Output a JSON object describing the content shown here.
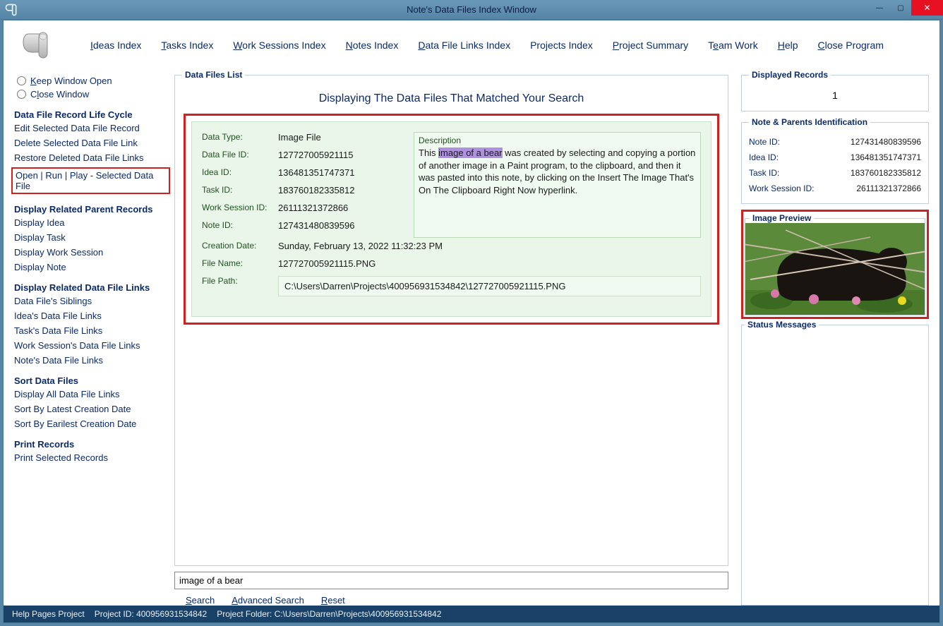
{
  "window": {
    "title": "Note's Data Files Index Window"
  },
  "menu": {
    "ideas": "Ideas Index",
    "tasks": "Tasks Index",
    "work_sessions": "Work Sessions Index",
    "notes": "Notes Index",
    "data_file_links": "Data File Links Index",
    "projects": "Projects Index",
    "project_summary": "Project Summary",
    "team": "Team Work",
    "help": "Help",
    "close": "Close Program"
  },
  "left": {
    "keep_open": "Keep Window Open",
    "close_window": "Close Window",
    "section_lifecycle": "Data File Record Life Cycle",
    "edit_selected": "Edit Selected Data File Record",
    "delete_link": "Delete Selected Data File Link",
    "restore_links": "Restore Deleted Data File Links",
    "open_run_play": "Open | Run | Play - Selected Data File",
    "section_parents": "Display Related Parent Records",
    "display_idea": "Display Idea",
    "display_task": "Display Task",
    "display_ws": "Display Work Session",
    "display_note": "Display Note",
    "section_links": "Display Related Data File Links",
    "siblings": "Data File's Siblings",
    "idea_links": "Idea's Data File Links",
    "task_links": "Task's Data File Links",
    "ws_links": "Work Session's Data File Links",
    "note_links": "Note's Data File Links",
    "section_sort": "Sort Data Files",
    "display_all": "Display All Data File Links",
    "sort_latest": "Sort By Latest Creation Date",
    "sort_earliest": "Sort By Earilest Creation Date",
    "section_print": "Print Records",
    "print_selected": "Print Selected Records"
  },
  "center": {
    "legend": "Data Files List",
    "title": "Displaying The Data Files That Matched Your Search",
    "record": {
      "labels": {
        "data_type": "Data Type:",
        "data_file_id": "Data File ID:",
        "idea_id": "Idea ID:",
        "task_id": "Task ID:",
        "ws_id": "Work Session ID:",
        "note_id": "Note ID:",
        "creation_date": "Creation Date:",
        "file_name": "File Name:",
        "file_path": "File Path:",
        "description": "Description"
      },
      "data_type": "Image File",
      "data_file_id": "127727005921115",
      "idea_id": "136481351747371",
      "task_id": "183760182335812",
      "ws_id": "26111321372866",
      "note_id": "127431480839596",
      "creation_date": "Sunday, February 13, 2022   11:32:23 PM",
      "file_name": "127727005921115.PNG",
      "file_path": "C:\\Users\\Darren\\Projects\\400956931534842\\127727005921115.PNG",
      "description_pre": "This ",
      "description_hl": "image of a bear",
      "description_post": " was created by selecting and copying a portion of another image in a Paint program, to the clipboard, and then it was pasted into this note, by clicking on the Insert The Image That's On The Clipboard Right Now hyperlink."
    },
    "search": {
      "value": "image of a bear",
      "search_label": "Search",
      "advanced_label": "Advanced Search",
      "reset_label": "Reset"
    }
  },
  "right": {
    "displayed_legend": "Displayed Records",
    "displayed_count": "1",
    "ids_legend": "Note & Parents Identification",
    "ids": {
      "note_id_label": "Note ID:",
      "note_id": "127431480839596",
      "idea_id_label": "Idea ID:",
      "idea_id": "136481351747371",
      "task_id_label": "Task ID:",
      "task_id": "183760182335812",
      "ws_id_label": "Work Session ID:",
      "ws_id": "26111321372866"
    },
    "preview_legend": "Image Preview",
    "status_legend": "Status Messages"
  },
  "statusbar": {
    "help_pages": "Help Pages Project",
    "project_id": "Project ID:  400956931534842",
    "project_folder": "Project Folder: C:\\Users\\Darren\\Projects\\400956931534842"
  }
}
